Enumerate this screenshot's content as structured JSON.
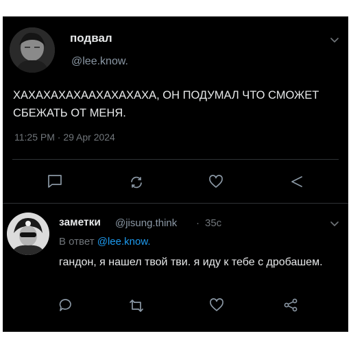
{
  "main_tweet": {
    "display_name": "подвал",
    "handle": "@lee.know.",
    "text": "ХАХАХАХАХААХАХАХАХА, ОН ПОДУМАЛ ЧТО СМОЖЕТ СБЕЖАТЬ ОТ МЕНЯ.",
    "timestamp": "11:25 PM · 29 Apr 2024",
    "actions": [
      "reply-icon",
      "retweet-icon",
      "like-icon",
      "share-icon"
    ]
  },
  "reply_tweet": {
    "display_name": "заметки",
    "handle": "@jisung.think",
    "separator": "·",
    "time": "35с",
    "reply_to_label": "В ответ",
    "reply_to_handle": "@lee.know.",
    "text": "гандон, я нашел твой тви. я иду к тебе с дробашем.",
    "actions": [
      "reply-icon",
      "retweet-icon",
      "like-icon",
      "share-icon"
    ]
  },
  "colors": {
    "background": "#000000",
    "text": "#e7e9ea",
    "muted": "#71767b",
    "link": "#1d9bf0"
  }
}
